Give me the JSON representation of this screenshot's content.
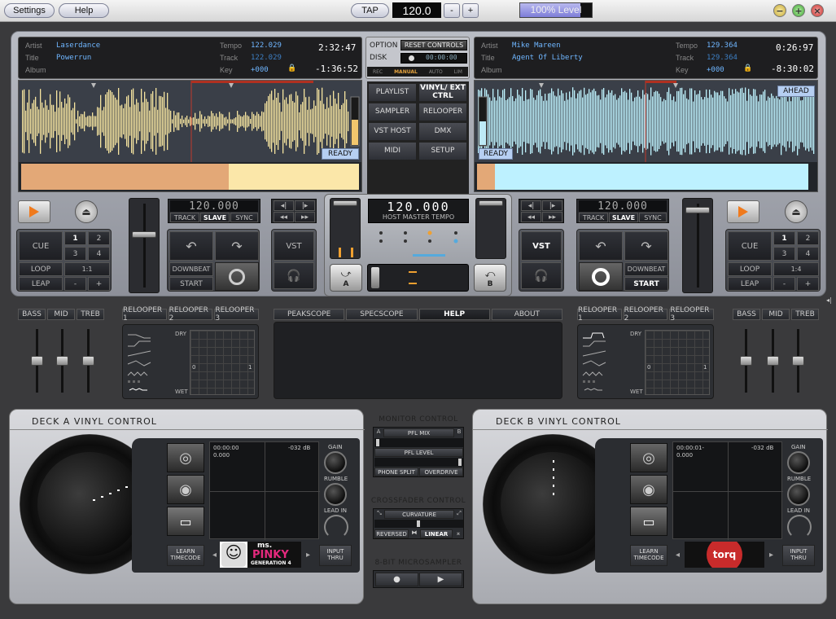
{
  "titlebar": {
    "settings_label": "Settings",
    "help_label": "Help",
    "tap_label": "TAP",
    "bpm_value": "120.0",
    "minus_label": "-",
    "plus_label": "+",
    "level_text": "100% Level"
  },
  "deck_a": {
    "artist_label": "Artist",
    "artist": "Laserdance",
    "title_label": "Title",
    "title": "Powerrun",
    "album_label": "Album",
    "album": "",
    "tempo_label": "Tempo",
    "tempo": "122.029",
    "track_label": "Track",
    "track": "122.029",
    "key_label": "Key",
    "key": "+000",
    "elapsed": "2:32:47",
    "remaining": "-1:36:52",
    "status": "READY",
    "tempo_lcd": "120.000",
    "track_btn": "TRACK",
    "slave_btn": "SLAVE",
    "sync_btn": "SYNC",
    "cue": "CUE",
    "loop": "LOOP",
    "leap": "LEAP",
    "nums": [
      "1",
      "2",
      "3",
      "4"
    ],
    "loop_len": "1:1",
    "minus": "-",
    "plus": "+",
    "vst": "VST",
    "downbeat": "DOWNBEAT",
    "start": "START",
    "xfader_label": "A"
  },
  "deck_b": {
    "artist_label": "Artist",
    "artist": "Mike Mareen",
    "title_label": "Title",
    "title": "Agent Of Liberty",
    "album_label": "Album",
    "album": "",
    "tempo_label": "Tempo",
    "tempo": "129.364",
    "track_label": "Track",
    "track": "129.364",
    "key_label": "Key",
    "key": "+000",
    "elapsed": "0:26:97",
    "remaining": "-8:30:02",
    "status": "READY",
    "ahead": "AHEAD",
    "tempo_lcd": "120.000",
    "track_btn": "TRACK",
    "slave_btn": "SLAVE",
    "sync_btn": "SYNC",
    "cue": "CUE",
    "loop": "LOOP",
    "leap": "LEAP",
    "nums": [
      "1",
      "2",
      "3",
      "4"
    ],
    "loop_len": "1:4",
    "minus": "-",
    "plus": "+",
    "vst": "VST",
    "downbeat": "DOWNBEAT",
    "start": "START",
    "xfader_label": "B"
  },
  "center": {
    "option_label": "OPTION",
    "disk_label": "DISK",
    "reset_controls": "RESET CONTROLS",
    "disk_time": "00:00:00",
    "modes": [
      "REC",
      "MANUAL",
      "AUTO",
      "LIM"
    ],
    "grid": [
      [
        "PLAYLIST",
        "VINYL/ EXT CTRL"
      ],
      [
        "SAMPLER",
        "RELOOPER"
      ],
      [
        "VST HOST",
        "DMX"
      ],
      [
        "MIDI",
        "SETUP"
      ]
    ],
    "master_tempo": "120.000",
    "host_master_tempo": "HOST MASTER TEMPO"
  },
  "eq": {
    "bass": "BASS",
    "mid": "MID",
    "treb": "TREB"
  },
  "relooper_tabs": [
    "RELOOPER 1",
    "RELOOPER 2",
    "RELOOPER 3"
  ],
  "relooper_axis": {
    "dry": "DRY",
    "wet": "WET",
    "zero": "0",
    "one": "1"
  },
  "scope_tabs": [
    "PEAKSCOPE",
    "SPECSCOPE",
    "HELP",
    "ABOUT"
  ],
  "vinyl_a": {
    "title": "DECK A VINYL CONTROL",
    "time": "00:00:00",
    "value": "0.000",
    "db": "-032 dB",
    "gain": "GAIN",
    "rumble": "RUMBLE",
    "lead_in": "LEAD IN",
    "learn": "LEARN TIMECODE",
    "input": "INPUT THRU",
    "logo_line1": "ms.",
    "logo_line2": "PINKY",
    "logo_line3": "GENERATION 4"
  },
  "vinyl_b": {
    "title": "DECK B VINYL CONTROL",
    "time": "00:00:01-",
    "value": "0.000",
    "db": "-032 dB",
    "gain": "GAIN",
    "rumble": "RUMBLE",
    "lead_in": "LEAD IN",
    "learn": "LEARN TIMECODE",
    "input": "INPUT THRU",
    "logo_text": "torq"
  },
  "monitor": {
    "title": "MONITOR CONTROL",
    "pfl_mix": "PFL MIX",
    "a": "A",
    "b": "B",
    "pfl_level": "PFL LEVEL",
    "phone_split": "PHONE SPLIT",
    "overdrive": "OVERDRIVE"
  },
  "crossfader": {
    "title": "CROSSFADER CONTROL",
    "curvature": "CURVATURE",
    "reversed": "REVERSED",
    "linear": "LINEAR"
  },
  "sampler": {
    "title": "8-BIT MICROSAMPLER"
  }
}
